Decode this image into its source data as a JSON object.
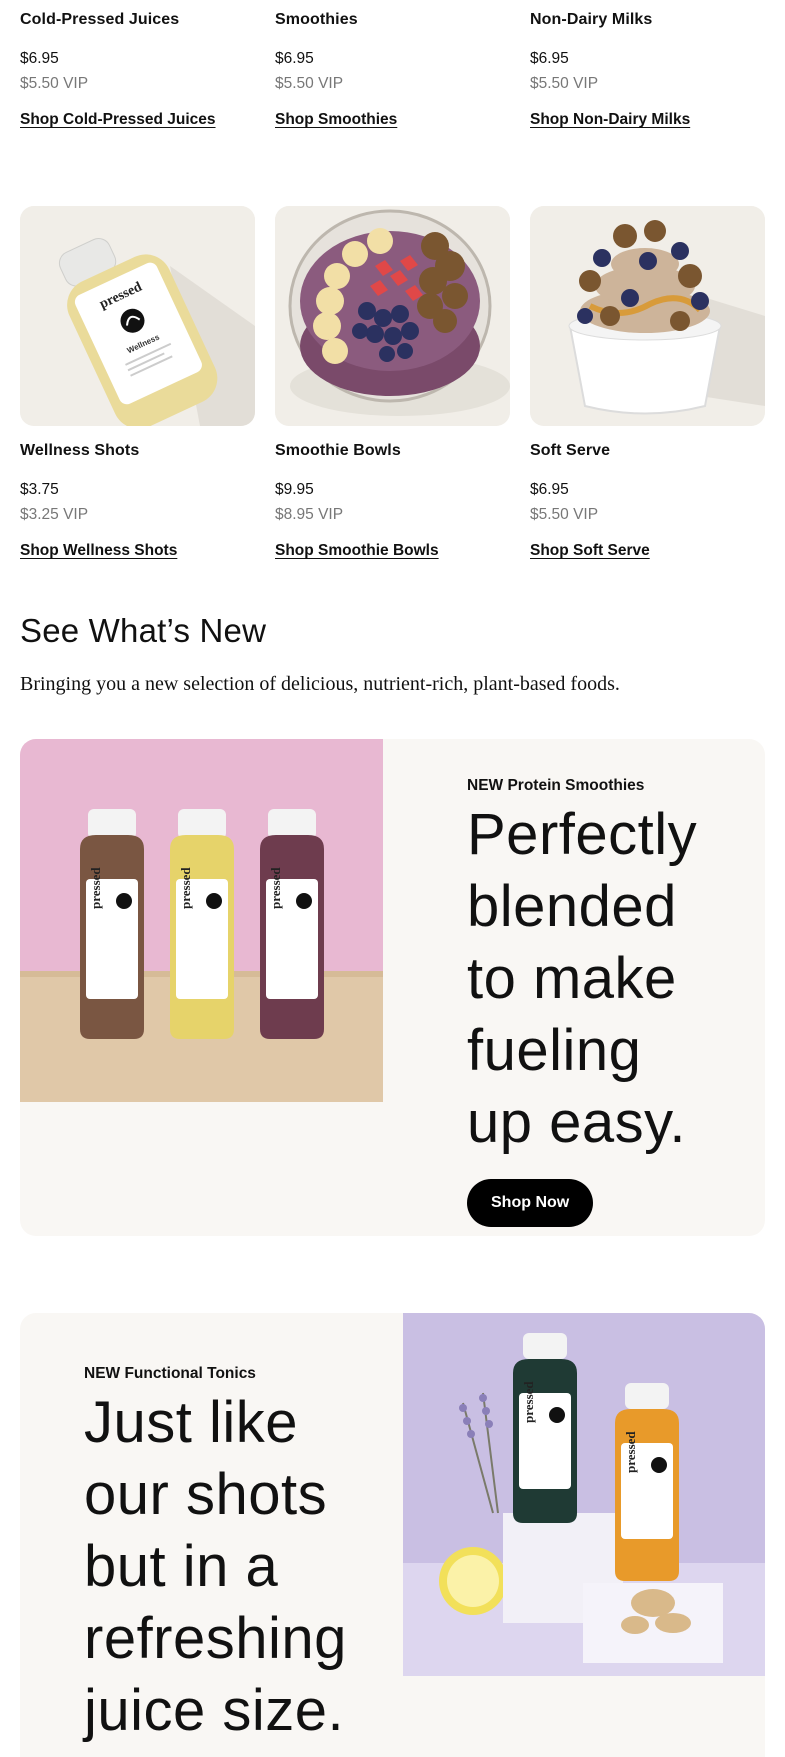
{
  "top_row": [
    {
      "name": "Cold-Pressed Juices",
      "price": "$6.95",
      "vip": "$5.50 VIP",
      "shop": "Shop Cold-Pressed Juices"
    },
    {
      "name": "Smoothies",
      "price": "$6.95",
      "vip": "$5.50 VIP",
      "shop": "Shop Smoothies"
    },
    {
      "name": "Non-Dairy Milks",
      "price": "$6.95",
      "vip": "$5.50 VIP",
      "shop": "Shop Non-Dairy Milks"
    }
  ],
  "second_row": [
    {
      "name": "Wellness Shots",
      "price": "$3.75",
      "vip": "$3.25 VIP",
      "shop": "Shop Wellness Shots",
      "image": "wellness-shot-bottle"
    },
    {
      "name": "Smoothie Bowls",
      "price": "$9.95",
      "vip": "$8.95 VIP",
      "shop": "Shop Smoothie Bowls",
      "image": "acai-smoothie-bowl"
    },
    {
      "name": "Soft Serve",
      "price": "$6.95",
      "vip": "$5.50 VIP",
      "shop": "Shop Soft Serve",
      "image": "soft-serve-cup"
    }
  ],
  "whats_new": {
    "title": "See What’s New",
    "subtitle": "Bringing you a new selection of delicious, nutrient-rich, plant-based foods."
  },
  "promo_protein": {
    "eyebrow": "NEW Protein Smoothies",
    "headline_lines": [
      "Perfectly",
      "blended",
      "to make",
      "fueling",
      "up easy."
    ],
    "button": "Shop Now",
    "bottle_labels": [
      "pressed",
      "pressed",
      "pressed"
    ]
  },
  "promo_tonics": {
    "eyebrow": "NEW Functional Tonics",
    "headline_lines": [
      "Just like",
      "our shots",
      "but in a",
      "refreshing",
      "juice size."
    ],
    "bottle_labels": [
      "pressed",
      "pressed"
    ]
  },
  "colors": {
    "card_bg": "#f9f7f4",
    "pink_backdrop": "#e8b8d2",
    "lavender_backdrop": "#c9bfe3",
    "button_bg": "#000000"
  }
}
